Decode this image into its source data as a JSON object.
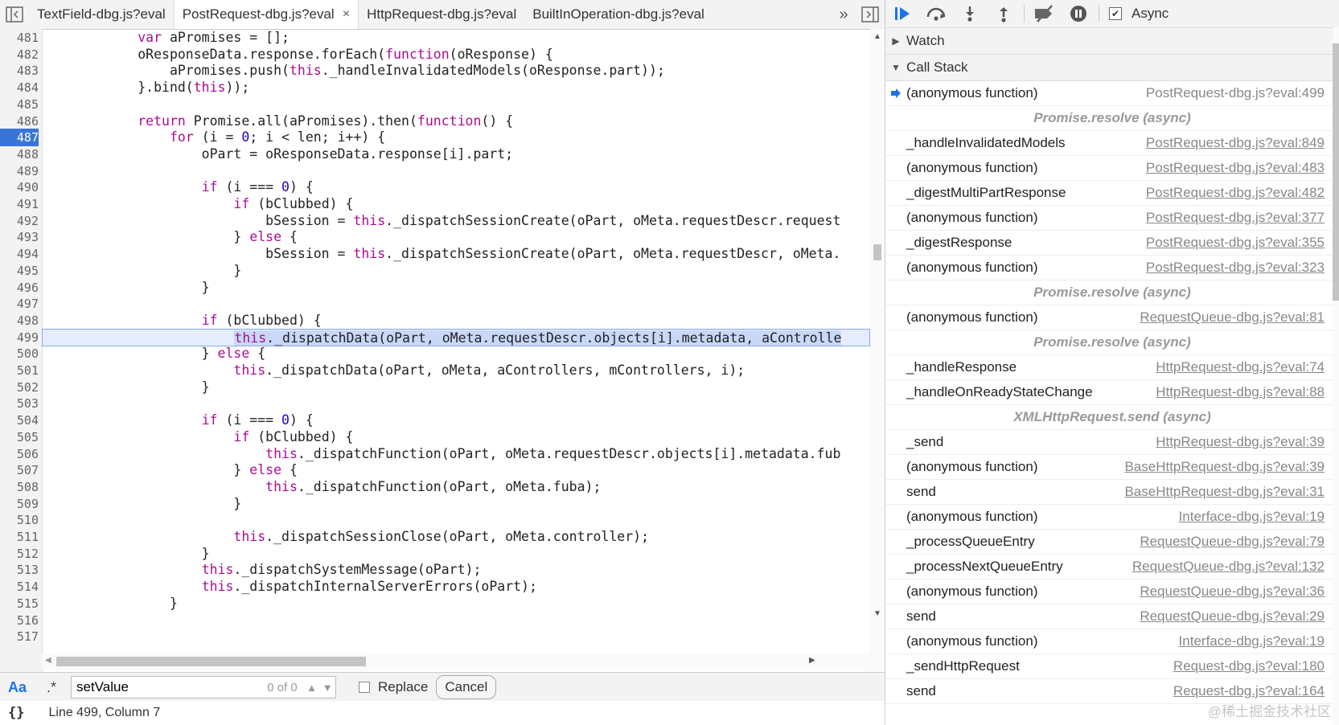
{
  "tabs": [
    {
      "label": "TextField-dbg.js?eval",
      "active": false
    },
    {
      "label": "PostRequest-dbg.js?eval",
      "active": true,
      "close": "×"
    },
    {
      "label": "HttpRequest-dbg.js?eval",
      "active": false
    },
    {
      "label": "BuiltInOperation-dbg.js?eval",
      "active": false
    }
  ],
  "tab_overflow": "»",
  "editor": {
    "lines": [
      {
        "n": "481",
        "text": "            var aPromises = [];"
      },
      {
        "n": "482",
        "text": "            oResponseData.response.forEach(function(oResponse) {"
      },
      {
        "n": "483",
        "text": "                aPromises.push(this._handleInvalidatedModels(oResponse.part));"
      },
      {
        "n": "484",
        "text": "            }.bind(this));"
      },
      {
        "n": "485",
        "text": ""
      },
      {
        "n": "486",
        "text": "            return Promise.all(aPromises).then(function() {"
      },
      {
        "n": "487",
        "text": "                for (i = 0; i < len; i++) {"
      },
      {
        "n": "488",
        "text": "                    oPart = oResponseData.response[i].part;"
      },
      {
        "n": "489",
        "text": ""
      },
      {
        "n": "490",
        "text": "                    if (i === 0) {"
      },
      {
        "n": "491",
        "text": "                        if (bClubbed) {"
      },
      {
        "n": "492",
        "text": "                            bSession = this._dispatchSessionCreate(oPart, oMeta.requestDescr.request"
      },
      {
        "n": "493",
        "text": "                        } else {"
      },
      {
        "n": "494",
        "text": "                            bSession = this._dispatchSessionCreate(oPart, oMeta.requestDescr, oMeta."
      },
      {
        "n": "495",
        "text": "                        }"
      },
      {
        "n": "496",
        "text": "                    }"
      },
      {
        "n": "497",
        "text": ""
      },
      {
        "n": "498",
        "text": "                    if (bClubbed) {"
      },
      {
        "n": "499",
        "text": "                        this._dispatchData(oPart, oMeta.requestDescr.objects[i].metadata, aControlle"
      },
      {
        "n": "500",
        "text": "                    } else {"
      },
      {
        "n": "501",
        "text": "                        this._dispatchData(oPart, oMeta, aControllers, mControllers, i);"
      },
      {
        "n": "502",
        "text": "                    }"
      },
      {
        "n": "503",
        "text": ""
      },
      {
        "n": "504",
        "text": "                    if (i === 0) {"
      },
      {
        "n": "505",
        "text": "                        if (bClubbed) {"
      },
      {
        "n": "506",
        "text": "                            this._dispatchFunction(oPart, oMeta.requestDescr.objects[i].metadata.fub"
      },
      {
        "n": "507",
        "text": "                        } else {"
      },
      {
        "n": "508",
        "text": "                            this._dispatchFunction(oPart, oMeta.fuba);"
      },
      {
        "n": "509",
        "text": "                        }"
      },
      {
        "n": "510",
        "text": ""
      },
      {
        "n": "511",
        "text": "                        this._dispatchSessionClose(oPart, oMeta.controller);"
      },
      {
        "n": "512",
        "text": "                    }"
      },
      {
        "n": "513",
        "text": "                    this._dispatchSystemMessage(oPart);"
      },
      {
        "n": "514",
        "text": "                    this._dispatchInternalServerErrors(oPart);"
      },
      {
        "n": "515",
        "text": "                }"
      },
      {
        "n": "516",
        "text": ""
      },
      {
        "n": "517",
        "text": ""
      }
    ],
    "exec_line": "487",
    "paused_line": "499"
  },
  "find": {
    "case_label": "Aa",
    "regex_label": ".*",
    "value": "setValue",
    "count": "0 of 0",
    "replace_label": "Replace",
    "cancel_label": "Cancel"
  },
  "status": {
    "braces": "{}",
    "position": "Line 499, Column 7"
  },
  "debugger": {
    "async_label": "Async",
    "async_checked": true,
    "watch_label": "Watch",
    "callstack_label": "Call Stack"
  },
  "callstack": [
    {
      "type": "frame",
      "fn": "(anonymous function)",
      "loc": "PostRequest-dbg.js?eval:499",
      "current": true
    },
    {
      "type": "async",
      "label": "Promise.resolve (async)"
    },
    {
      "type": "frame",
      "fn": "_handleInvalidatedModels",
      "loc": "PostRequest-dbg.js?eval:849"
    },
    {
      "type": "frame",
      "fn": "(anonymous function)",
      "loc": "PostRequest-dbg.js?eval:483"
    },
    {
      "type": "frame",
      "fn": "_digestMultiPartResponse",
      "loc": "PostRequest-dbg.js?eval:482"
    },
    {
      "type": "frame",
      "fn": "(anonymous function)",
      "loc": "PostRequest-dbg.js?eval:377"
    },
    {
      "type": "frame",
      "fn": "_digestResponse",
      "loc": "PostRequest-dbg.js?eval:355"
    },
    {
      "type": "frame",
      "fn": "(anonymous function)",
      "loc": "PostRequest-dbg.js?eval:323"
    },
    {
      "type": "async",
      "label": "Promise.resolve (async)"
    },
    {
      "type": "frame",
      "fn": "(anonymous function)",
      "loc": "RequestQueue-dbg.js?eval:81"
    },
    {
      "type": "async",
      "label": "Promise.resolve (async)"
    },
    {
      "type": "frame",
      "fn": "_handleResponse",
      "loc": "HttpRequest-dbg.js?eval:74"
    },
    {
      "type": "frame",
      "fn": "_handleOnReadyStateChange",
      "loc": "HttpRequest-dbg.js?eval:88"
    },
    {
      "type": "async",
      "label": "XMLHttpRequest.send (async)"
    },
    {
      "type": "frame",
      "fn": "_send",
      "loc": "HttpRequest-dbg.js?eval:39"
    },
    {
      "type": "frame",
      "fn": "(anonymous function)",
      "loc": "BaseHttpRequest-dbg.js?eval:39"
    },
    {
      "type": "frame",
      "fn": "send",
      "loc": "BaseHttpRequest-dbg.js?eval:31"
    },
    {
      "type": "frame",
      "fn": "(anonymous function)",
      "loc": "Interface-dbg.js?eval:19"
    },
    {
      "type": "frame",
      "fn": "_processQueueEntry",
      "loc": "RequestQueue-dbg.js?eval:79"
    },
    {
      "type": "frame",
      "fn": "_processNextQueueEntry",
      "loc": "RequestQueue-dbg.js?eval:132"
    },
    {
      "type": "frame",
      "fn": "(anonymous function)",
      "loc": "RequestQueue-dbg.js?eval:36"
    },
    {
      "type": "frame",
      "fn": "send",
      "loc": "RequestQueue-dbg.js?eval:29"
    },
    {
      "type": "frame",
      "fn": "(anonymous function)",
      "loc": "Interface-dbg.js?eval:19"
    },
    {
      "type": "frame",
      "fn": "_sendHttpRequest",
      "loc": "Request-dbg.js?eval:180"
    },
    {
      "type": "frame",
      "fn": "send",
      "loc": "Request-dbg.js?eval:164"
    }
  ],
  "watermark": "@稀土掘金技术社区",
  "colors": {
    "accent": "#1a73e8",
    "exec_line_bg": "#3875d7",
    "keyword": "#aa0d91",
    "number": "#1c00cf"
  }
}
